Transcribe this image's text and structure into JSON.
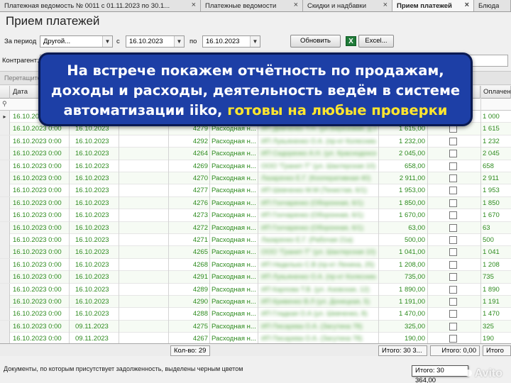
{
  "tabs": [
    {
      "label": "Платежная ведомость № 0011 с 01.11.2023 по 30.1...",
      "active": false,
      "closable": true
    },
    {
      "label": "Платежные ведомости",
      "active": false,
      "closable": true
    },
    {
      "label": "Скидки и надбавки",
      "active": false,
      "closable": true
    },
    {
      "label": "Прием платежей",
      "active": true,
      "closable": true
    },
    {
      "label": "Блюда",
      "active": false,
      "closable": false
    }
  ],
  "close_glyph": "×",
  "page_title": "Прием платежей",
  "filters": {
    "period_label": "За период",
    "period_value": "Другой...",
    "from_label": "с",
    "from_value": "16.10.2023",
    "to_label": "по",
    "to_value": "16.10.2023",
    "refresh_label": "Обновить",
    "excel_label": "Excel...",
    "counterparty_label": "Контрагент:",
    "drag_hint": "Перетащите..."
  },
  "grid": {
    "headers": [
      "Дата",
      "",
      "",
      "",
      "",
      "",
      "",
      "",
      "Оплачено"
    ],
    "rows": [
      {
        "date1": "16.10.2023 0:00",
        "date2": "16.10.2023",
        "num": "",
        "type": "",
        "name": "",
        "amount": "",
        "paid": "1 000"
      },
      {
        "date1": "16.10.2023 0:00",
        "date2": "16.10.2023",
        "num": "4279",
        "type": "Расходная н...",
        "name": "ИП Демченко Т.Н. (ул.Березовая, д.3)",
        "amount": "1 615,00",
        "paid": "1 615"
      },
      {
        "date1": "16.10.2023 0:00",
        "date2": "16.10.2023",
        "num": "4292",
        "type": "Расходная н...",
        "name": "ИП Лукьяненко О.А. (пр-кт Колесника)",
        "amount": "1 232,00",
        "paid": "1 232"
      },
      {
        "date1": "16.10.2023 0:00",
        "date2": "16.10.2023",
        "num": "4264",
        "type": "Расходная н...",
        "name": "ИП Сидоренко А.Н. (ул. Краснодонская)",
        "amount": "2 045,00",
        "paid": "2 045"
      },
      {
        "date1": "16.10.2023 0:00",
        "date2": "16.10.2023",
        "num": "4269",
        "type": "Расходная н...",
        "name": "ООО \"Гранит-Т\" (ул. Шахтерская 10)",
        "amount": "658,00",
        "paid": "658"
      },
      {
        "date1": "16.10.2023 0:00",
        "date2": "16.10.2023",
        "num": "4270",
        "type": "Расходная н...",
        "name": "Лазаренко Е.Г. (Кооперативная 40)",
        "amount": "2 911,00",
        "paid": "2 911"
      },
      {
        "date1": "16.10.2023 0:00",
        "date2": "16.10.2023",
        "num": "4277",
        "type": "Расходная н...",
        "name": "ИП Шевченко М.М (Тенистая, 6/1)",
        "amount": "1 953,00",
        "paid": "1 953"
      },
      {
        "date1": "16.10.2023 0:00",
        "date2": "16.10.2023",
        "num": "4276",
        "type": "Расходная н...",
        "name": "ИП Гончаренко (Оборонная, 6/1)",
        "amount": "1 850,00",
        "paid": "1 850"
      },
      {
        "date1": "16.10.2023 0:00",
        "date2": "16.10.2023",
        "num": "4273",
        "type": "Расходная н...",
        "name": "ИП Гончаренко (Оборонная, 6/1)",
        "amount": "1 670,00",
        "paid": "1 670"
      },
      {
        "date1": "16.10.2023 0:00",
        "date2": "16.10.2023",
        "num": "4272",
        "type": "Расходная н...",
        "name": "ИП Гончаренко (Оборонная, 6/1)",
        "amount": "63,00",
        "paid": "63"
      },
      {
        "date1": "16.10.2023 0:00",
        "date2": "16.10.2023",
        "num": "4271",
        "type": "Расходная н...",
        "name": "Лазаренко Е.Г. (Рабочая 21а)",
        "amount": "500,00",
        "paid": "500"
      },
      {
        "date1": "16.10.2023 0:00",
        "date2": "16.10.2023",
        "num": "4265",
        "type": "Расходная н...",
        "name": "ООО \"Гранит-Т\" (ул. Шахтерская 10)",
        "amount": "1 041,00",
        "paid": "1 041"
      },
      {
        "date1": "16.10.2023 0:00",
        "date2": "16.10.2023",
        "num": "4268",
        "type": "Расходная н...",
        "name": "ИП Неделько С.В (пр-кт Ленина, 25)",
        "amount": "1 208,00",
        "paid": "1 208"
      },
      {
        "date1": "16.10.2023 0:00",
        "date2": "16.10.2023",
        "num": "4291",
        "type": "Расходная н...",
        "name": "ИП Лукьяненко О.А. (пр-кт Колесника)",
        "amount": "735,00",
        "paid": "735"
      },
      {
        "date1": "16.10.2023 0:00",
        "date2": "16.10.2023",
        "num": "4289",
        "type": "Расходная н...",
        "name": "ИП Карпова Т.В. (ул. Азовская, 12)",
        "amount": "1 890,00",
        "paid": "1 890"
      },
      {
        "date1": "16.10.2023 0:00",
        "date2": "16.10.2023",
        "num": "4290",
        "type": "Расходная н...",
        "name": "ИП Кривенко В.Л (ул. Донецкая, 5)",
        "amount": "1 191,00",
        "paid": "1 191"
      },
      {
        "date1": "16.10.2023 0:00",
        "date2": "16.10.2023",
        "num": "4288",
        "type": "Расходная н...",
        "name": "ИП Гладкая О.А (ул. Шевченко, 8)",
        "amount": "1 470,00",
        "paid": "1 470"
      },
      {
        "date1": "16.10.2023 0:00",
        "date2": "09.11.2023",
        "num": "4275",
        "type": "Расходная н...",
        "name": "ИП Писарева О.А. (Загутина 78)",
        "amount": "325,00",
        "paid": "325"
      },
      {
        "date1": "16.10.2023 0:00",
        "date2": "09.11.2023",
        "num": "4267",
        "type": "Расходная н...",
        "name": "ИП Писарева О.А. (Загутина 78)",
        "amount": "190,00",
        "paid": "190"
      }
    ]
  },
  "footer": {
    "count": "Кол-во: 29",
    "total": "Итого: 30 3...",
    "total2": "Итого: 0,00",
    "total3": "Итого",
    "note": "Документы, по которым присутствует задолженность, выделены черным цветом",
    "tooltip": "Итого: 30 364,00"
  },
  "banner": {
    "line1": "На встрече покажем отчётность по продажам,",
    "line2": "доходы и расходы, деятельность ведём в системе",
    "line3": "автоматизации iiko,",
    "line3_highlight": "готовы на любые проверки"
  },
  "watermark": "Avito",
  "colors": {
    "row_text": "#2e8b1f",
    "banner_bg": "#1d3fa6",
    "banner_highlight": "#ffe62e"
  }
}
